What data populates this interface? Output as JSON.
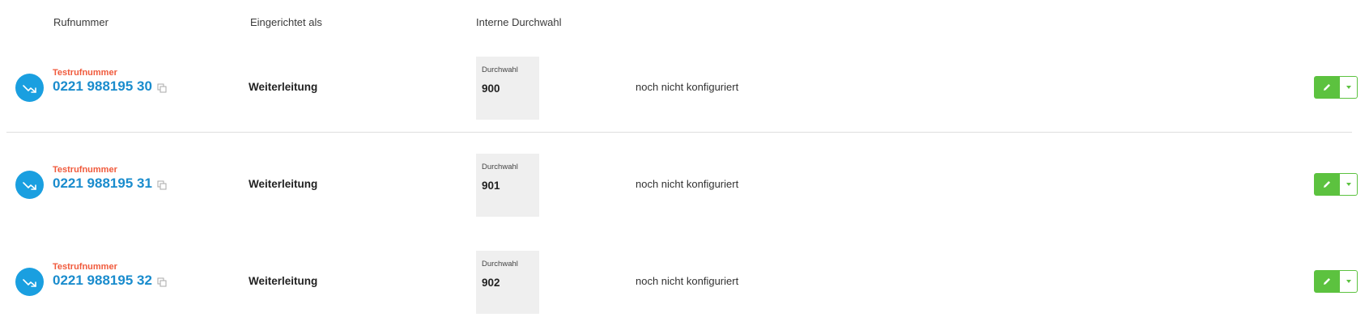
{
  "header": {
    "col_number": "Rufnummer",
    "col_setup": "Eingerichtet als",
    "col_extension": "Interne Durchwahl"
  },
  "colors": {
    "icon_bg": "#1a9fe0",
    "tag": "#f05a3c",
    "number": "#1a8ccd",
    "action_green": "#5cc23f",
    "extension_bg": "#efefef"
  },
  "rows": [
    {
      "tag": "Testrufnummer",
      "number": "0221 988195 30",
      "setup": "Weiterleitung",
      "extension_label": "Durchwahl",
      "extension": "900",
      "status": "noch nicht konfiguriert",
      "icon": "trending-up-arrow-icon"
    },
    {
      "tag": "Testrufnummer",
      "number": "0221 988195 31",
      "setup": "Weiterleitung",
      "extension_label": "Durchwahl",
      "extension": "901",
      "status": "noch nicht konfiguriert",
      "icon": "trending-up-arrow-icon"
    },
    {
      "tag": "Testrufnummer",
      "number": "0221 988195 32",
      "setup": "Weiterleitung",
      "extension_label": "Durchwahl",
      "extension": "902",
      "status": "noch nicht konfiguriert",
      "icon": "trending-up-arrow-icon"
    }
  ]
}
